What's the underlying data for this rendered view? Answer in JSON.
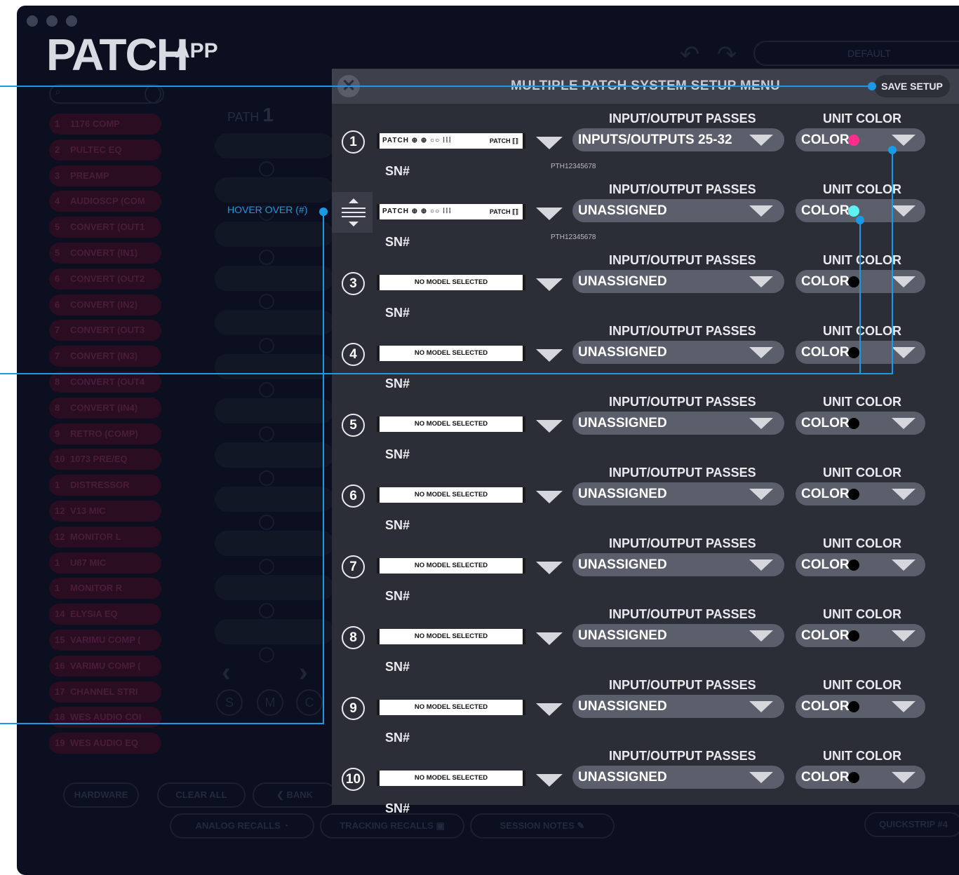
{
  "app": {
    "logo_main": "PATCH",
    "logo_small": "APP",
    "preset": "DEFAULT"
  },
  "sidebar": {
    "channels": [
      {
        "num": "1",
        "label": "1176 COMP"
      },
      {
        "num": "2",
        "label": "PULTEC EQ"
      },
      {
        "num": "3",
        "label": "PREAMP"
      },
      {
        "num": "4",
        "label": "AUDIOSCP (COM"
      },
      {
        "num": "5",
        "label": "CONVERT (OUT1"
      },
      {
        "num": "5",
        "label": "CONVERT (IN1)"
      },
      {
        "num": "6",
        "label": "CONVERT (OUT2"
      },
      {
        "num": "6",
        "label": "CONVERT (IN2)"
      },
      {
        "num": "7",
        "label": "CONVERT (OUT3"
      },
      {
        "num": "7",
        "label": "CONVERT (IN3)"
      },
      {
        "num": "8",
        "label": "CONVERT (OUT4"
      },
      {
        "num": "8",
        "label": "CONVERT (IN4)"
      },
      {
        "num": "9",
        "label": "RETRO (COMP)"
      },
      {
        "num": "10",
        "label": "1073 PRE/EQ"
      },
      {
        "num": "1",
        "label": "DISTRESSOR"
      },
      {
        "num": "12",
        "label": "V13 MIC"
      },
      {
        "num": "12",
        "label": "MONITOR L"
      },
      {
        "num": "1",
        "label": "U87 MIC"
      },
      {
        "num": "1",
        "label": "MONITOR R"
      },
      {
        "num": "14",
        "label": "ELYSIA EQ"
      },
      {
        "num": "15",
        "label": "VARIMU COMP ("
      },
      {
        "num": "16",
        "label": "VARIMU COMP ("
      },
      {
        "num": "17",
        "label": "CHANNEL STRI"
      },
      {
        "num": "18",
        "label": "WES AUDIO COI"
      },
      {
        "num": "19",
        "label": "WES AUDIO EQ"
      }
    ]
  },
  "main": {
    "path_label": "PATH",
    "path_number": "1",
    "bank_label": "BANK"
  },
  "bottom_bar": {
    "hardware": "HARDWARE",
    "clear_all": "CLEAR ALL",
    "analog_recalls": "ANALOG RECALLS",
    "tracking_recalls": "TRACKING RECALLS",
    "session_notes": "SESSION NOTES",
    "quickstrip": "QUICKSTRIP #4"
  },
  "modal": {
    "title": "MULTIPLE PATCH SYSTEM SETUP MENU",
    "save_label": "SAVE SETUP",
    "close_glyph": "✕",
    "io_header": "INPUT/OUTPUT PASSES",
    "color_header": "UNIT COLOR",
    "sn_label": "SN#",
    "color_label": "COLOR",
    "units": [
      {
        "index": "1",
        "model": "device",
        "model_text": "PATCH ⊕ ⊕  ○○  ⁞⁞⁞",
        "model_right": "PATCH ⟦⟧",
        "serial": "PTH12345678",
        "io": "INPUTS/OUTPUTS 25-32",
        "color": "#ff2d8e"
      },
      {
        "index": "2",
        "model": "device",
        "model_text": "PATCH ⊕ ⊕  ○○  ⁞⁞⁞",
        "model_right": "PATCH ⟦⟧",
        "serial": "PTH12345678",
        "io": "UNASSIGNED",
        "color": "#5ff0f5"
      },
      {
        "index": "3",
        "model": "none",
        "model_text": "NO MODEL SELECTED",
        "serial": "",
        "io": "UNASSIGNED",
        "color": "#000000"
      },
      {
        "index": "4",
        "model": "none",
        "model_text": "NO MODEL SELECTED",
        "serial": "",
        "io": "UNASSIGNED",
        "color": "#000000"
      },
      {
        "index": "5",
        "model": "none",
        "model_text": "NO MODEL SELECTED",
        "serial": "",
        "io": "UNASSIGNED",
        "color": "#000000"
      },
      {
        "index": "6",
        "model": "none",
        "model_text": "NO MODEL SELECTED",
        "serial": "",
        "io": "UNASSIGNED",
        "color": "#000000"
      },
      {
        "index": "7",
        "model": "none",
        "model_text": "NO MODEL SELECTED",
        "serial": "",
        "io": "UNASSIGNED",
        "color": "#000000"
      },
      {
        "index": "8",
        "model": "none",
        "model_text": "NO MODEL SELECTED",
        "serial": "",
        "io": "UNASSIGNED",
        "color": "#000000"
      },
      {
        "index": "9",
        "model": "none",
        "model_text": "NO MODEL SELECTED",
        "serial": "",
        "io": "UNASSIGNED",
        "color": "#000000"
      },
      {
        "index": "10",
        "model": "none",
        "model_text": "NO MODEL SELECTED",
        "serial": "",
        "io": "UNASSIGNED",
        "color": "#000000"
      }
    ]
  },
  "annotation": {
    "hover_label": "HOVER OVER (#)",
    "accent_color": "#1a9ae6"
  }
}
